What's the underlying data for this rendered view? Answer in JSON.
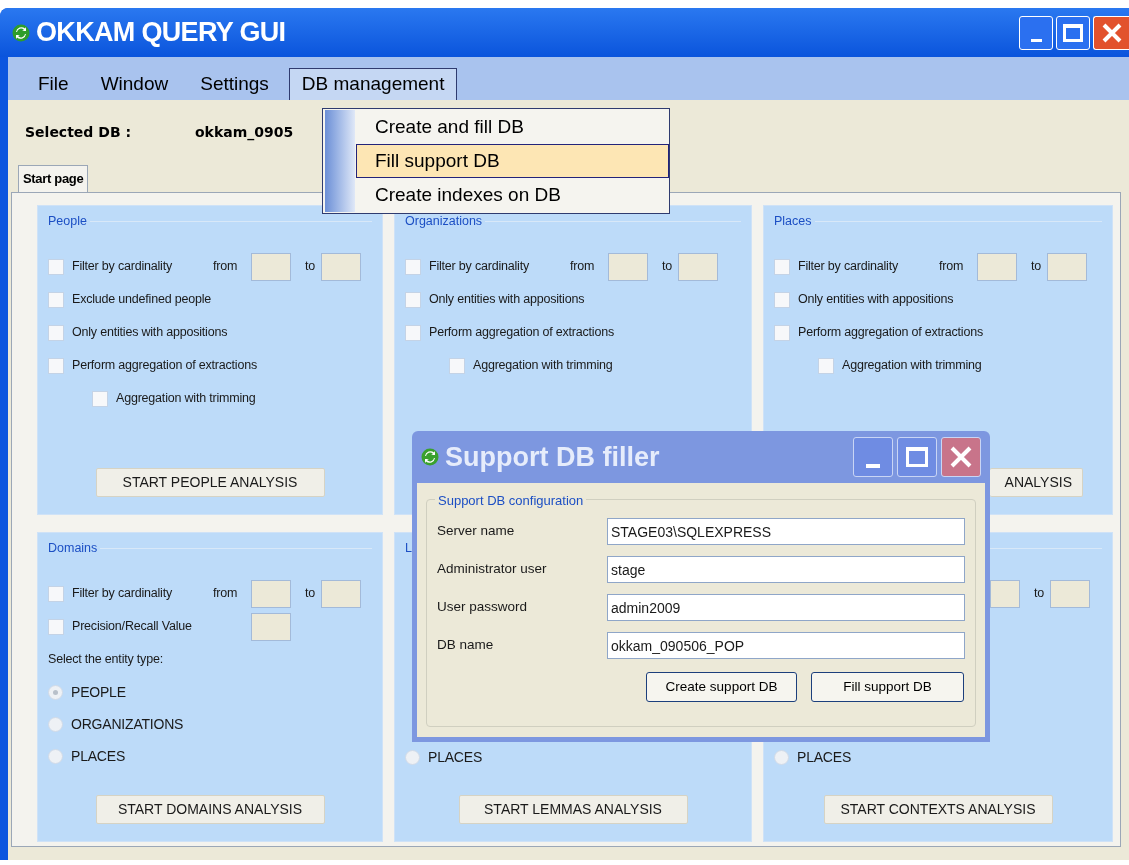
{
  "window": {
    "title": "OKKAM QUERY GUI"
  },
  "menu": [
    {
      "label": "File",
      "selected": false
    },
    {
      "label": "Window",
      "selected": false
    },
    {
      "label": "Settings",
      "selected": false
    },
    {
      "label": "DB management",
      "selected": true
    }
  ],
  "dropdown": [
    {
      "label": "Create and fill DB",
      "selected": false
    },
    {
      "label": "Fill support DB",
      "selected": true
    },
    {
      "label": "Create indexes on DB",
      "selected": false
    }
  ],
  "selected_db": {
    "label": "Selected DB :",
    "value": "okkam_0905"
  },
  "tabs": [
    {
      "label": "Start page",
      "selected": true
    }
  ],
  "panels": [
    {
      "title": "People",
      "items": [
        {
          "kind": "range",
          "label": "Filter by cardinality",
          "from": "from",
          "to": "to",
          "checked": false
        },
        {
          "kind": "checkbox",
          "label": "Exclude undefined people",
          "checked": false
        },
        {
          "kind": "checkbox",
          "label": "Only entities with appositions",
          "checked": false
        },
        {
          "kind": "checkbox",
          "label": "Perform aggregation of extractions",
          "checked": false,
          "children": [
            {
              "kind": "checkbox",
              "label": "Aggregation with trimming",
              "checked": false
            }
          ]
        }
      ],
      "button": "START PEOPLE ANALYSIS"
    },
    {
      "title": "Organizations",
      "items": [
        {
          "kind": "range",
          "label": "Filter by cardinality",
          "from": "from",
          "to": "to",
          "checked": false
        },
        {
          "kind": "checkbox",
          "label": "Only entities with appositions",
          "checked": false
        },
        {
          "kind": "checkbox",
          "label": "Perform aggregation of extractions",
          "checked": false,
          "children": [
            {
              "kind": "checkbox",
              "label": "Aggregation with trimming",
              "checked": false
            }
          ]
        }
      ]
    },
    {
      "title": "Places",
      "items": [
        {
          "kind": "range",
          "label": "Filter by cardinality",
          "from": "from",
          "to": "to",
          "checked": false
        },
        {
          "kind": "checkbox",
          "label": "Only entities with appositions",
          "checked": false
        },
        {
          "kind": "checkbox",
          "label": "Perform aggregation of extractions",
          "checked": false,
          "children": [
            {
              "kind": "checkbox",
              "label": "Aggregation with trimming",
              "checked": false
            }
          ]
        }
      ],
      "button": "ANALYSIS"
    },
    {
      "title": "Domains",
      "items": [
        {
          "kind": "range",
          "label": "Filter by cardinality",
          "from": "from",
          "to": "to",
          "checked": false
        },
        {
          "kind": "value",
          "label": "Precision/Recall Value",
          "checked": false
        },
        {
          "kind": "caption",
          "label": "Select the entity type:"
        },
        {
          "kind": "radio",
          "label": "PEOPLE",
          "selected": true
        },
        {
          "kind": "radio",
          "label": "ORGANIZATIONS",
          "selected": false
        },
        {
          "kind": "radio",
          "label": "PLACES",
          "selected": false
        }
      ],
      "button": "START DOMAINS ANALYSIS"
    },
    {
      "title": "L",
      "footer": [
        {
          "kind": "radio",
          "label": "PLACES",
          "selected": false
        }
      ],
      "button": "START LEMMAS ANALYSIS"
    },
    {
      "items": [
        {
          "kind": "range",
          "to": "to"
        }
      ],
      "footer": [
        {
          "kind": "radio",
          "label": "PLACES",
          "selected": false
        }
      ],
      "button": "START CONTEXTS ANALYSIS"
    }
  ],
  "dialog": {
    "title": "Support DB filler",
    "group": "Support DB configuration",
    "fields": [
      {
        "label": "Server name",
        "value": "STAGE03\\SQLEXPRESS"
      },
      {
        "label": "Administrator user",
        "value": "stage"
      },
      {
        "label": "User password",
        "value": "admin2009"
      },
      {
        "label": "DB name",
        "value": "okkam_090506_POP"
      }
    ],
    "buttons": [
      "Create support DB",
      "Fill support DB"
    ]
  }
}
